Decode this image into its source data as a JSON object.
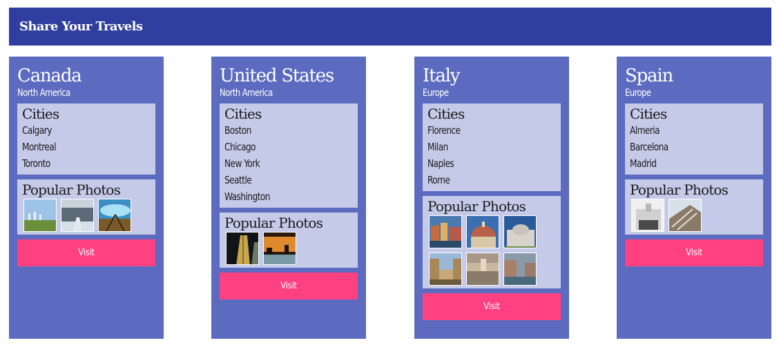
{
  "header": {
    "title": "Share Your Travels"
  },
  "countries": [
    {
      "name": "Canada",
      "continent": "North America",
      "cities_title": "Cities",
      "cities": [
        "Calgary",
        "Montreal",
        "Toronto"
      ],
      "photos_title": "Popular Photos",
      "photos": [
        "field-photo",
        "snowy-road-photo",
        "tree-sky-photo"
      ],
      "visit_label": "Visit"
    },
    {
      "name": "United States",
      "continent": "North America",
      "cities_title": "Cities",
      "cities": [
        "Boston",
        "Chicago",
        "New York",
        "Seattle",
        "Washington"
      ],
      "photos_title": "Popular Photos",
      "photos": [
        "skyscraper-photo",
        "sunset-lake-photo"
      ],
      "visit_label": "Visit"
    },
    {
      "name": "Italy",
      "continent": "Europe",
      "cities_title": "Cities",
      "cities": [
        "Florence",
        "Milan",
        "Naples",
        "Rome"
      ],
      "photos_title": "Popular Photos",
      "photos": [
        "canal-houses-photo",
        "duomo-photo",
        "cathedral-photo",
        "courtyard-photo",
        "piazza-photo",
        "venice-photo"
      ],
      "visit_label": "Visit"
    },
    {
      "name": "Spain",
      "continent": "Europe",
      "cities_title": "Cities",
      "cities": [
        "Almeria",
        "Barcelona",
        "Madrid"
      ],
      "photos_title": "Popular Photos",
      "photos": [
        "palace-photo",
        "market-roof-photo"
      ],
      "visit_label": "Visit"
    }
  ]
}
